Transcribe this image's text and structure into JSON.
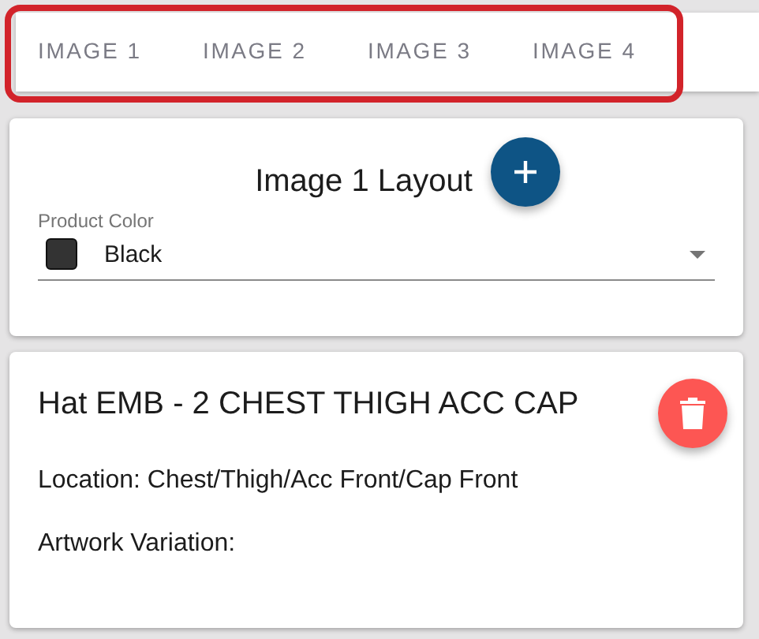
{
  "tabs": [
    {
      "label": "IMAGE 1",
      "selected": false
    },
    {
      "label": "IMAGE 2",
      "selected": false
    },
    {
      "label": "IMAGE 3",
      "selected": false
    },
    {
      "label": "IMAGE 4",
      "selected": false
    }
  ],
  "layout_card": {
    "title": "Image 1 Layout",
    "product_color": {
      "label": "Product Color",
      "value": "Black",
      "color": "#333333"
    }
  },
  "item_card": {
    "title": "Hat EMB - 2 CHEST THIGH ACC CAP",
    "location": "Location: Chest/Thigh/Acc Front/Cap Front",
    "artwork_variation": "Artwork Variation:"
  }
}
